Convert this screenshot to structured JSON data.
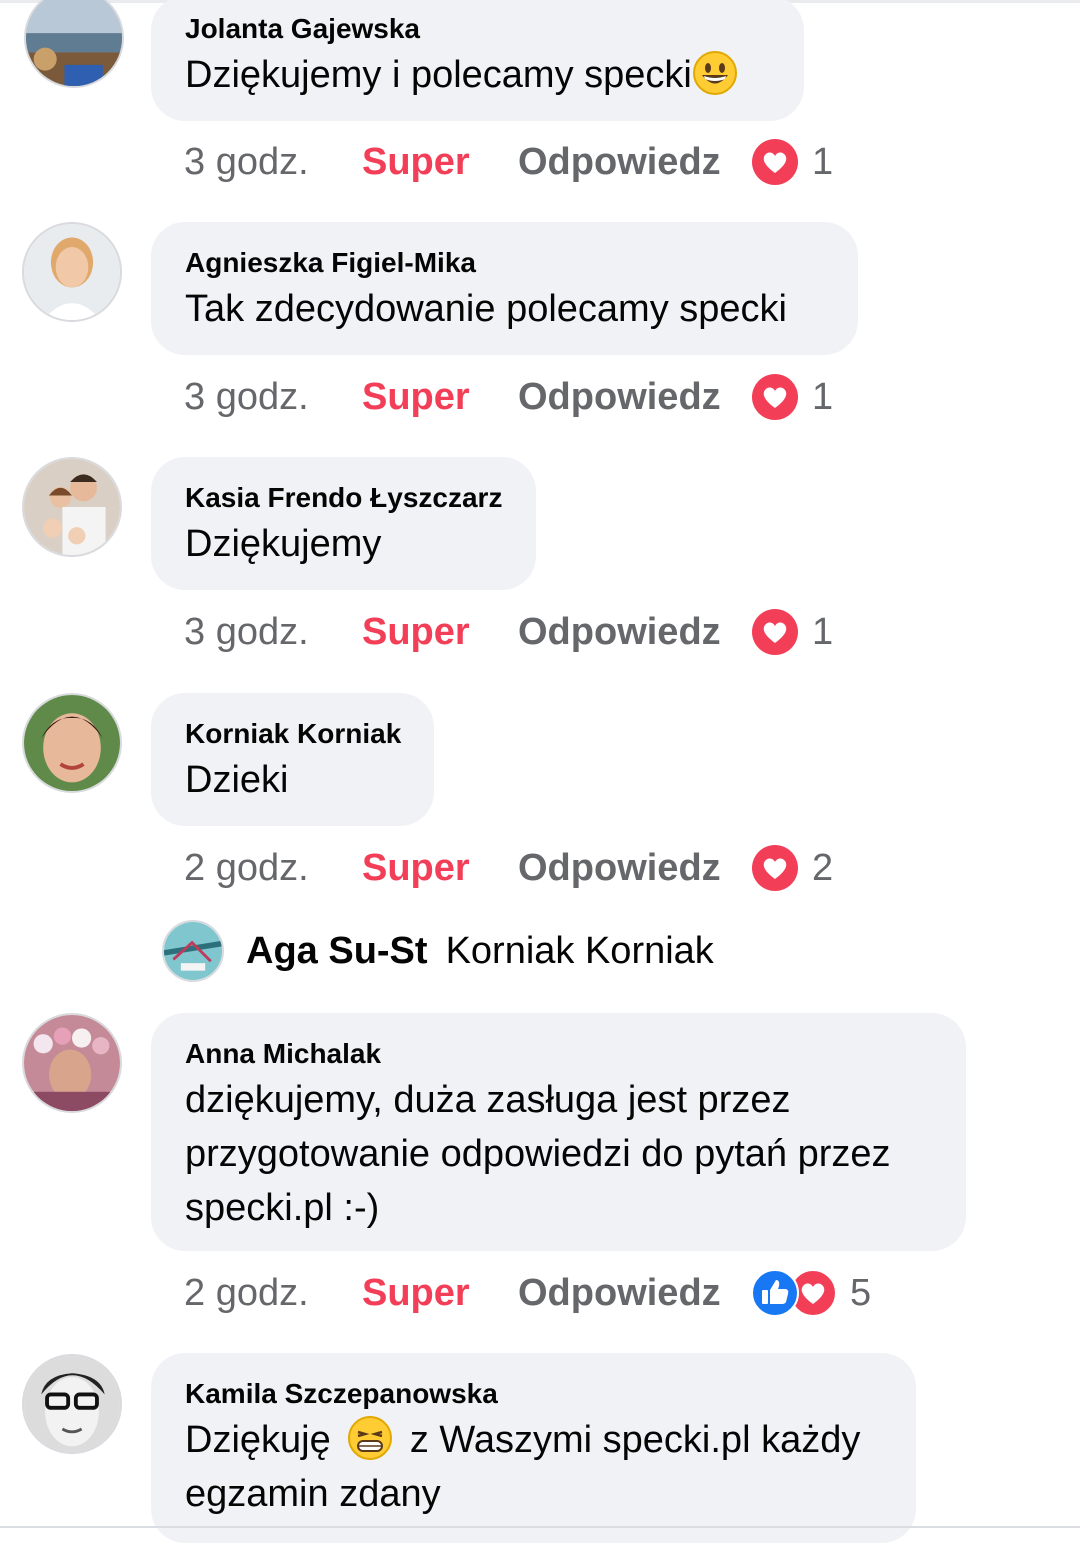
{
  "comments": [
    {
      "author": "Jolanta Gajewska",
      "text": "Dziękujemy i polecamy specki",
      "emoji": "grinning-face",
      "time": "3 godz.",
      "like_label": "Super",
      "reply_label": "Odpowiedz",
      "reaction_types": [
        "love"
      ],
      "reaction_count": "1"
    },
    {
      "author": "Agnieszka Figiel-Mika",
      "text": "Tak zdecydowanie polecamy specki",
      "time": "3 godz.",
      "like_label": "Super",
      "reply_label": "Odpowiedz",
      "reaction_types": [
        "love"
      ],
      "reaction_count": "1"
    },
    {
      "author": "Kasia Frendo Łyszczarz",
      "text": "Dziękujemy",
      "time": "3 godz.",
      "like_label": "Super",
      "reply_label": "Odpowiedz",
      "reaction_types": [
        "love"
      ],
      "reaction_count": "1"
    },
    {
      "author": "Korniak Korniak",
      "text": "Dzieki",
      "time": "2 godz.",
      "like_label": "Super",
      "reply_label": "Odpowiedz",
      "reaction_types": [
        "love"
      ],
      "reaction_count": "2"
    },
    {
      "author": "Anna Michalak",
      "text_lines": [
        "dziękujemy, duża zasługa jest przez",
        "przygotowanie odpowiedzi do pytań przez",
        "specki.pl :-)"
      ],
      "time": "2 godz.",
      "like_label": "Super",
      "reply_label": "Odpowiedz",
      "reaction_types": [
        "like",
        "love"
      ],
      "reaction_count": "5"
    },
    {
      "author": "Kamila Szczepanowska",
      "text_before_emoji": "Dziękuję",
      "emoji": "grinning-squinting-face",
      "text_after_emoji": "z Waszymi specki.pl każdy",
      "text_line2": "egzamin zdany"
    }
  ],
  "reply_preview": {
    "author": "Aga Su-St",
    "text": "Korniak Korniak"
  },
  "colors": {
    "bubble": "#f0f2f5",
    "super_active": "#f33e58",
    "meta": "#65676b",
    "love": "#f33e58",
    "like": "#1877f2"
  }
}
